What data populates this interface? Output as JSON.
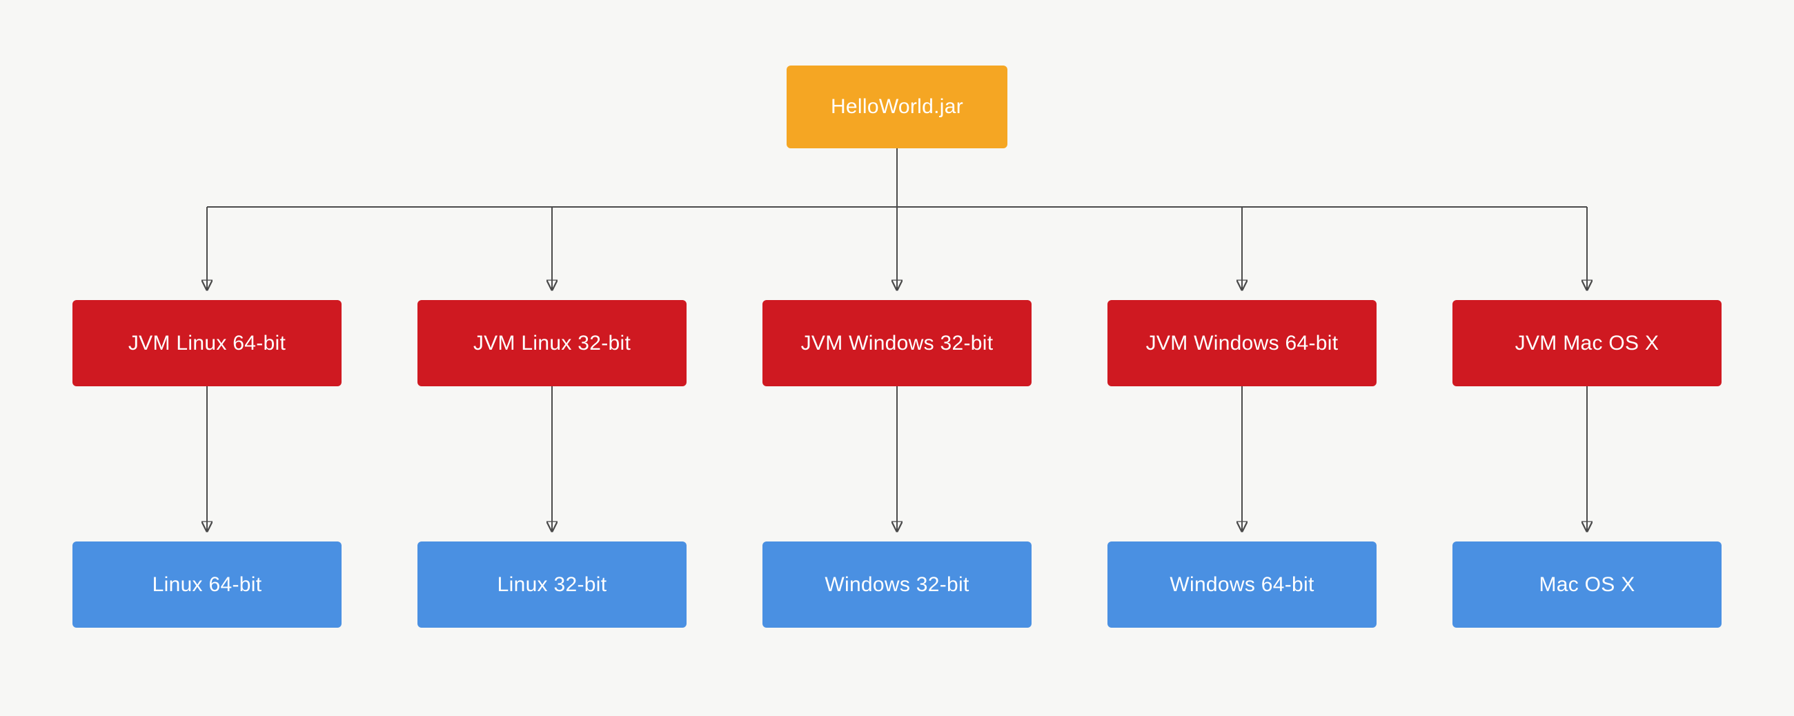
{
  "diagram": {
    "root": {
      "label": "HelloWorld.jar"
    },
    "jvm": [
      {
        "label": "JVM Linux 64-bit"
      },
      {
        "label": "JVM Linux 32-bit"
      },
      {
        "label": "JVM Windows 32-bit"
      },
      {
        "label": "JVM Windows 64-bit"
      },
      {
        "label": "JVM Mac OS X"
      }
    ],
    "os": [
      {
        "label": "Linux 64-bit"
      },
      {
        "label": "Linux 32-bit"
      },
      {
        "label": "Windows 32-bit"
      },
      {
        "label": "Windows 64-bit"
      },
      {
        "label": "Mac OS X"
      }
    ]
  },
  "colors": {
    "root": "#f5a623",
    "jvm": "#cf1921",
    "os": "#4a90e2",
    "edge": "#4a4a4a",
    "bg": "#f7f7f5"
  }
}
